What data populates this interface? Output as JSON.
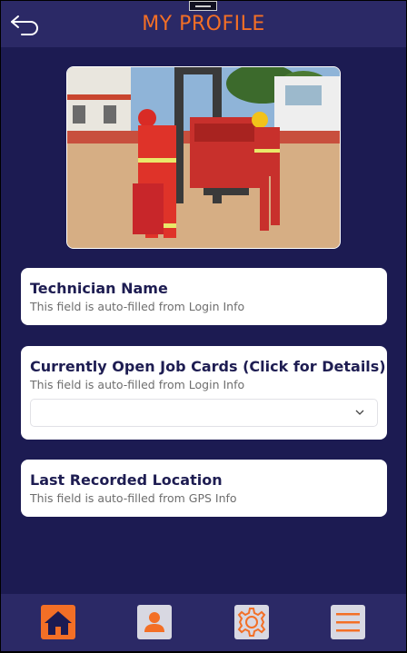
{
  "header": {
    "title": "MY PROFILE",
    "back_icon": "back-arrow-icon"
  },
  "profile_photo": {
    "description_icon": "technicians-photo"
  },
  "cards": {
    "technician": {
      "title": "Technician Name",
      "subtitle": "This field is auto-filled from Login Info"
    },
    "job_cards": {
      "title": "Currently Open Job Cards (Click for Details)",
      "subtitle": "This field is auto-filled from Login Info",
      "selected_value": ""
    },
    "location": {
      "title": "Last Recorded Location",
      "subtitle": "This field is auto-filled from GPS Info"
    }
  },
  "nav": {
    "items": [
      {
        "icon": "home-icon",
        "active": true
      },
      {
        "icon": "person-icon",
        "active": false
      },
      {
        "icon": "gear-icon",
        "active": false
      },
      {
        "icon": "hamburger-menu-icon",
        "active": false
      }
    ]
  },
  "colors": {
    "background": "#1c1b52",
    "bar": "#2b2966",
    "accent": "#f36f26",
    "card": "#ffffff",
    "card_title": "#1e1d52"
  }
}
